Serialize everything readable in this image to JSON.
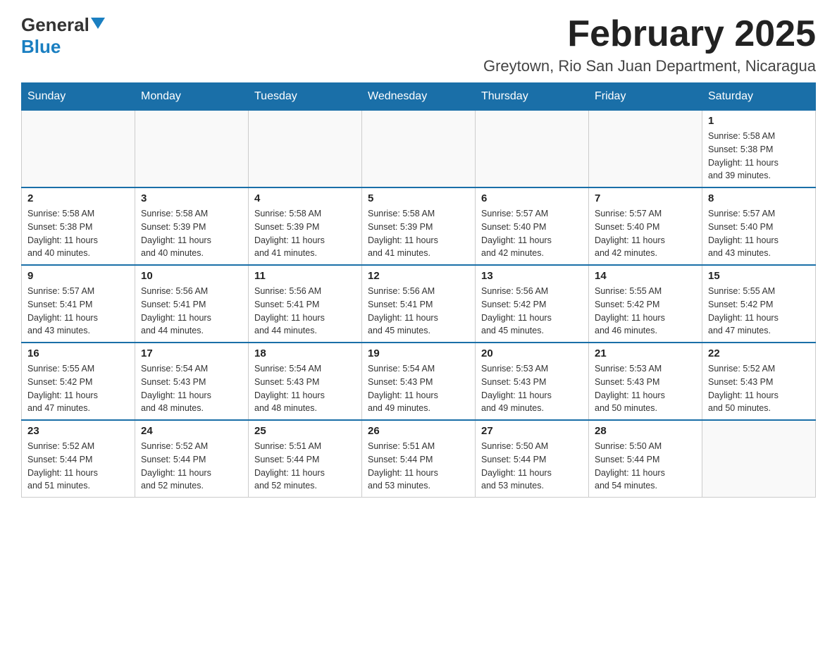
{
  "logo": {
    "general": "General",
    "blue": "Blue"
  },
  "title": "February 2025",
  "location": "Greytown, Rio San Juan Department, Nicaragua",
  "days_of_week": [
    "Sunday",
    "Monday",
    "Tuesday",
    "Wednesday",
    "Thursday",
    "Friday",
    "Saturday"
  ],
  "weeks": [
    {
      "days": [
        {
          "num": "",
          "info": ""
        },
        {
          "num": "",
          "info": ""
        },
        {
          "num": "",
          "info": ""
        },
        {
          "num": "",
          "info": ""
        },
        {
          "num": "",
          "info": ""
        },
        {
          "num": "",
          "info": ""
        },
        {
          "num": "1",
          "info": "Sunrise: 5:58 AM\nSunset: 5:38 PM\nDaylight: 11 hours\nand 39 minutes."
        }
      ]
    },
    {
      "days": [
        {
          "num": "2",
          "info": "Sunrise: 5:58 AM\nSunset: 5:38 PM\nDaylight: 11 hours\nand 40 minutes."
        },
        {
          "num": "3",
          "info": "Sunrise: 5:58 AM\nSunset: 5:39 PM\nDaylight: 11 hours\nand 40 minutes."
        },
        {
          "num": "4",
          "info": "Sunrise: 5:58 AM\nSunset: 5:39 PM\nDaylight: 11 hours\nand 41 minutes."
        },
        {
          "num": "5",
          "info": "Sunrise: 5:58 AM\nSunset: 5:39 PM\nDaylight: 11 hours\nand 41 minutes."
        },
        {
          "num": "6",
          "info": "Sunrise: 5:57 AM\nSunset: 5:40 PM\nDaylight: 11 hours\nand 42 minutes."
        },
        {
          "num": "7",
          "info": "Sunrise: 5:57 AM\nSunset: 5:40 PM\nDaylight: 11 hours\nand 42 minutes."
        },
        {
          "num": "8",
          "info": "Sunrise: 5:57 AM\nSunset: 5:40 PM\nDaylight: 11 hours\nand 43 minutes."
        }
      ]
    },
    {
      "days": [
        {
          "num": "9",
          "info": "Sunrise: 5:57 AM\nSunset: 5:41 PM\nDaylight: 11 hours\nand 43 minutes."
        },
        {
          "num": "10",
          "info": "Sunrise: 5:56 AM\nSunset: 5:41 PM\nDaylight: 11 hours\nand 44 minutes."
        },
        {
          "num": "11",
          "info": "Sunrise: 5:56 AM\nSunset: 5:41 PM\nDaylight: 11 hours\nand 44 minutes."
        },
        {
          "num": "12",
          "info": "Sunrise: 5:56 AM\nSunset: 5:41 PM\nDaylight: 11 hours\nand 45 minutes."
        },
        {
          "num": "13",
          "info": "Sunrise: 5:56 AM\nSunset: 5:42 PM\nDaylight: 11 hours\nand 45 minutes."
        },
        {
          "num": "14",
          "info": "Sunrise: 5:55 AM\nSunset: 5:42 PM\nDaylight: 11 hours\nand 46 minutes."
        },
        {
          "num": "15",
          "info": "Sunrise: 5:55 AM\nSunset: 5:42 PM\nDaylight: 11 hours\nand 47 minutes."
        }
      ]
    },
    {
      "days": [
        {
          "num": "16",
          "info": "Sunrise: 5:55 AM\nSunset: 5:42 PM\nDaylight: 11 hours\nand 47 minutes."
        },
        {
          "num": "17",
          "info": "Sunrise: 5:54 AM\nSunset: 5:43 PM\nDaylight: 11 hours\nand 48 minutes."
        },
        {
          "num": "18",
          "info": "Sunrise: 5:54 AM\nSunset: 5:43 PM\nDaylight: 11 hours\nand 48 minutes."
        },
        {
          "num": "19",
          "info": "Sunrise: 5:54 AM\nSunset: 5:43 PM\nDaylight: 11 hours\nand 49 minutes."
        },
        {
          "num": "20",
          "info": "Sunrise: 5:53 AM\nSunset: 5:43 PM\nDaylight: 11 hours\nand 49 minutes."
        },
        {
          "num": "21",
          "info": "Sunrise: 5:53 AM\nSunset: 5:43 PM\nDaylight: 11 hours\nand 50 minutes."
        },
        {
          "num": "22",
          "info": "Sunrise: 5:52 AM\nSunset: 5:43 PM\nDaylight: 11 hours\nand 50 minutes."
        }
      ]
    },
    {
      "days": [
        {
          "num": "23",
          "info": "Sunrise: 5:52 AM\nSunset: 5:44 PM\nDaylight: 11 hours\nand 51 minutes."
        },
        {
          "num": "24",
          "info": "Sunrise: 5:52 AM\nSunset: 5:44 PM\nDaylight: 11 hours\nand 52 minutes."
        },
        {
          "num": "25",
          "info": "Sunrise: 5:51 AM\nSunset: 5:44 PM\nDaylight: 11 hours\nand 52 minutes."
        },
        {
          "num": "26",
          "info": "Sunrise: 5:51 AM\nSunset: 5:44 PM\nDaylight: 11 hours\nand 53 minutes."
        },
        {
          "num": "27",
          "info": "Sunrise: 5:50 AM\nSunset: 5:44 PM\nDaylight: 11 hours\nand 53 minutes."
        },
        {
          "num": "28",
          "info": "Sunrise: 5:50 AM\nSunset: 5:44 PM\nDaylight: 11 hours\nand 54 minutes."
        },
        {
          "num": "",
          "info": ""
        }
      ]
    }
  ]
}
